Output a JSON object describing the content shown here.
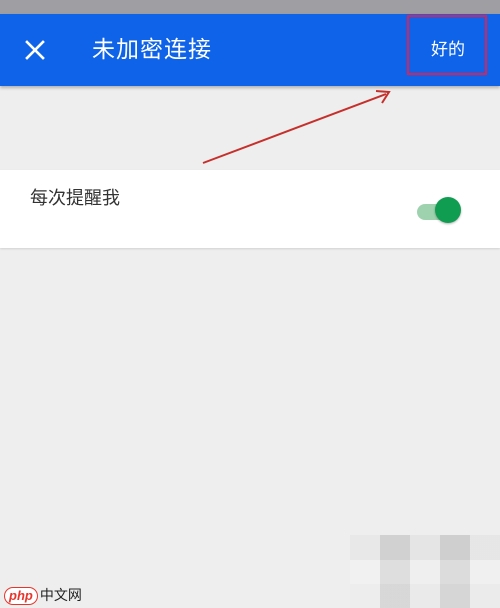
{
  "app_bar": {
    "title": "未加密连接",
    "ok_label": "好的",
    "close_icon": "close-icon",
    "background": "#0e63e8"
  },
  "setting": {
    "label": "每次提醒我",
    "toggle_on": true,
    "toggle_color": "#109d52"
  },
  "annotation": {
    "highlight_color": "#d6245a",
    "arrow_color": "#c6302c"
  },
  "watermark": {
    "brand": "php",
    "site": "中文网"
  }
}
